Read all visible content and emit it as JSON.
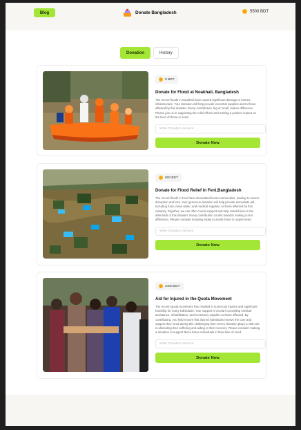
{
  "header": {
    "blog_label": "Blog",
    "brand_title": "Donate Bangladesh",
    "balance": "5500 BDT"
  },
  "tabs": [
    {
      "label": "Donation",
      "active": true
    },
    {
      "label": "History",
      "active": false
    }
  ],
  "colors": {
    "accent": "#a3e635",
    "coin": "#f59e0b",
    "header_bg": "#f7f6f2"
  },
  "cards": [
    {
      "amount": "0 BDT",
      "title": "Donate for Flood at Noakhali, Bangladesh",
      "description": "The recent floods in Noakhali have caused significant damage to homes, infrastructure. Your donation will help provide essential supplies and to those affected by this disaster. Every contribution, big or small, makes difference. Please join us in supporting the relief efforts and making a positive impact on the lives of those in need.",
      "input_placeholder": "Write Donation Amount",
      "button_label": "Donate Now",
      "image_icon": "rescue-boat-photo"
    },
    {
      "amount": "600 BDT",
      "title": "Donate for Flood Relief in Feni,Bangladesh",
      "description": "The recent floods in Feni have devastated local communities, leading to severe disruption and loss. Your generous donation will help provide immediate aid, including food, clean water, and medical supplies, to those affected by this calamity. Together, we can offer crucial support and help rebuild lives in the aftermath of this disaster. Every contribution counts towards making a real difference. Please consider donating today to assist those in urgent need.",
      "input_placeholder": "Write Donation Amount",
      "button_label": "Donate Now",
      "image_icon": "aerial-flood-photo"
    },
    {
      "amount": "2400 BDT",
      "title": "Aid for Injured in the Quota Movement",
      "description": "The recent Quota movement has resulted in numerous injuries and significant hardship for many individuals. Your support is crucial in providing medical assistance, rehabilitation, and necessary supplies to those affected. By contributing, you help ensure that injured individuals receive the care and support they need during this challenging time. Every donation plays a vital role in alleviating their suffering and aiding in their recovery. Please consider making a donation to support these brave individuals in their time of need.",
      "input_placeholder": "Write Donation Amount",
      "button_label": "Donate Now",
      "image_icon": "crowd-protest-photo"
    }
  ]
}
